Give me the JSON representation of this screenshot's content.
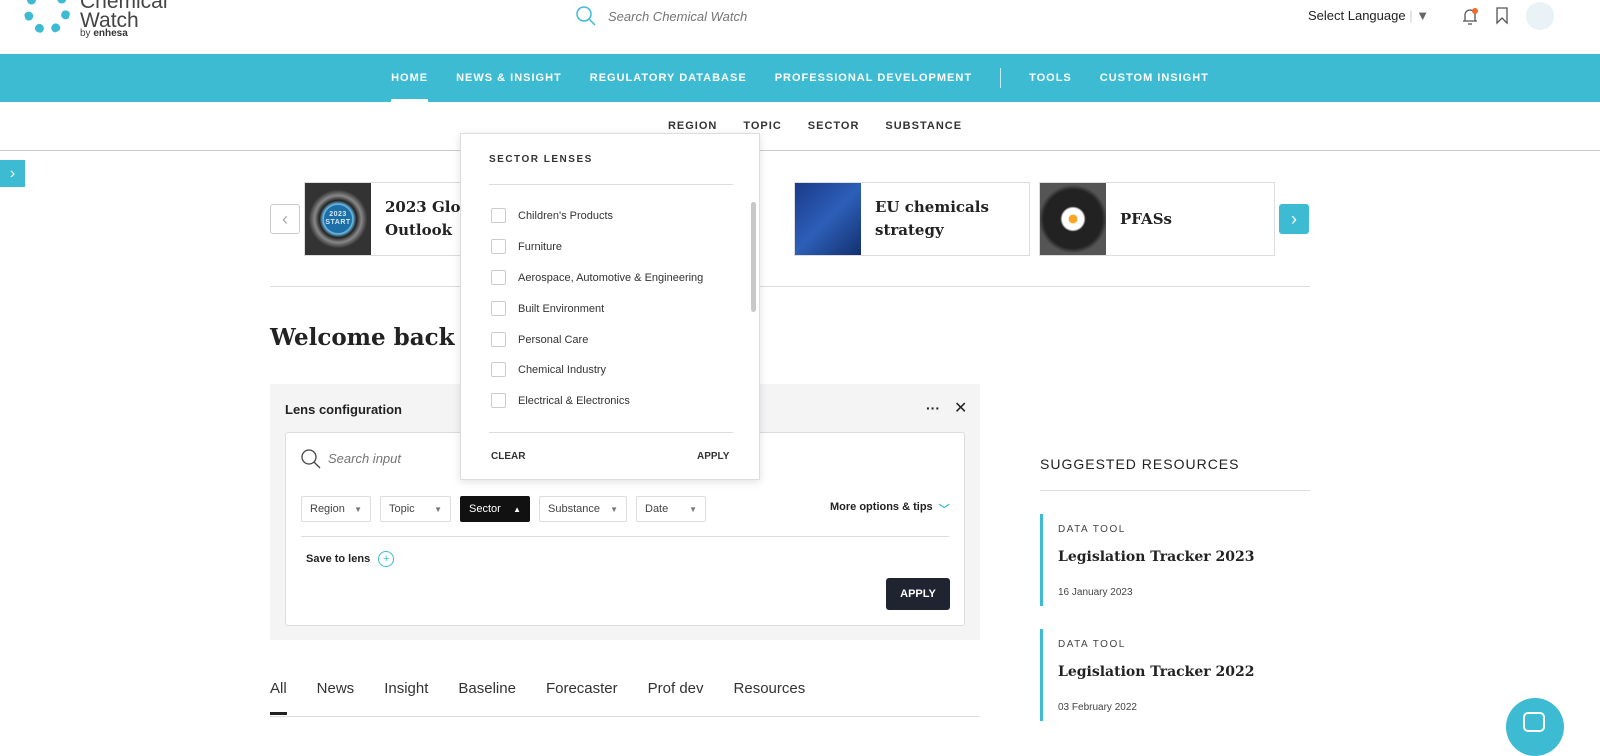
{
  "header": {
    "logo_line1": "Chemical",
    "logo_line2": "Watch",
    "logo_by": "by",
    "logo_brand": "enhesa",
    "search_placeholder": "Search Chemical Watch",
    "language": "Select Language"
  },
  "nav": {
    "items": [
      "HOME",
      "NEWS & INSIGHT",
      "REGULATORY DATABASE",
      "PROFESSIONAL DEVELOPMENT",
      "TOOLS",
      "CUSTOM INSIGHT"
    ]
  },
  "subnav": {
    "items": [
      "REGION",
      "TOPIC",
      "SECTOR",
      "SUBSTANCE"
    ]
  },
  "carousel": {
    "cards": [
      {
        "title": "2023 Global Outlook",
        "img_text": "2023 START"
      },
      {
        "title": "EU chemicals strategy"
      },
      {
        "title": "PFASs"
      }
    ]
  },
  "welcome": "Welcome back B",
  "lens": {
    "title": "Lens configuration",
    "search_placeholder": "Search input",
    "filters": [
      "Region",
      "Topic",
      "Sector",
      "Substance",
      "Date"
    ],
    "active_filter": "Sector",
    "more": "More options & tips",
    "save": "Save to lens",
    "apply": "APPLY"
  },
  "sector_popup": {
    "title": "SECTOR LENSES",
    "items": [
      "Children's Products",
      "Furniture",
      "Aerospace, Automotive & Engineering",
      "Built Environment",
      "Personal Care",
      "Chemical Industry",
      "Electrical & Electronics"
    ],
    "clear": "CLEAR",
    "apply": "APPLY"
  },
  "tabs": [
    "All",
    "News",
    "Insight",
    "Baseline",
    "Forecaster",
    "Prof dev",
    "Resources"
  ],
  "resources": {
    "title": "SUGGESTED RESOURCES",
    "items": [
      {
        "kind": "DATA TOOL",
        "name": "Legislation Tracker 2023",
        "date": "16 January 2023"
      },
      {
        "kind": "DATA TOOL",
        "name": "Legislation Tracker 2022",
        "date": "03 February 2022"
      }
    ]
  },
  "colors": {
    "accent": "#3dbbd3",
    "dark_button": "#1f2430"
  }
}
